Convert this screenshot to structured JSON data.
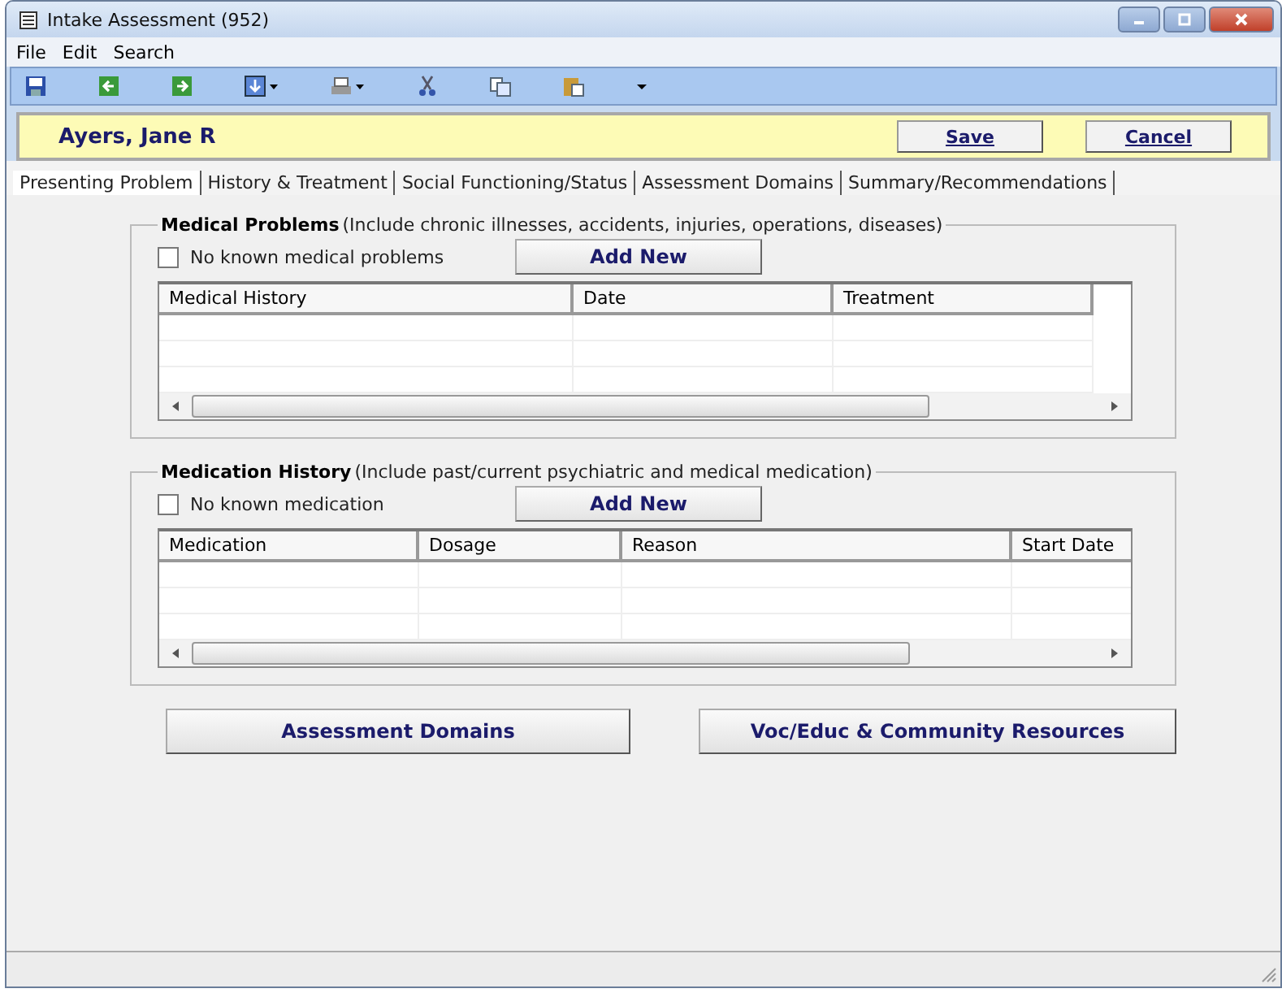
{
  "window": {
    "title": "Intake Assessment (952)"
  },
  "menu": [
    "File",
    "Edit",
    "Search"
  ],
  "client": {
    "name": "Ayers, Jane R",
    "buttons": [
      "Save",
      "Cancel"
    ]
  },
  "tabs": [
    {
      "label": "Presenting Problem",
      "selected": true
    },
    {
      "label": "History & Treatment",
      "selected": false
    },
    {
      "label": "Social Functioning/Status",
      "selected": false
    },
    {
      "label": "Assessment Domains",
      "selected": false
    },
    {
      "label": "Summary/Recommendations",
      "selected": false
    }
  ],
  "groups": [
    {
      "title": "Medical Problems",
      "note": "(Include chronic illnesses, accidents, injuries, operations, diseases)",
      "checkbox": {
        "label": "No known medical problems",
        "checked": false
      },
      "add_button": "Add New",
      "columns": [
        "Medical History",
        "Date",
        "Treatment"
      ]
    },
    {
      "title": "Medication History",
      "note": "(Include  past/current psychiatric and medical medication)",
      "checkbox": {
        "label": "No known medication",
        "checked": false
      },
      "add_button": "Add New",
      "columns": [
        "Medication",
        "Dosage",
        "Reason",
        "Start Date"
      ]
    }
  ],
  "bottom_buttons": [
    "Assessment Domains",
    "Voc/Educ & Community Resources"
  ]
}
